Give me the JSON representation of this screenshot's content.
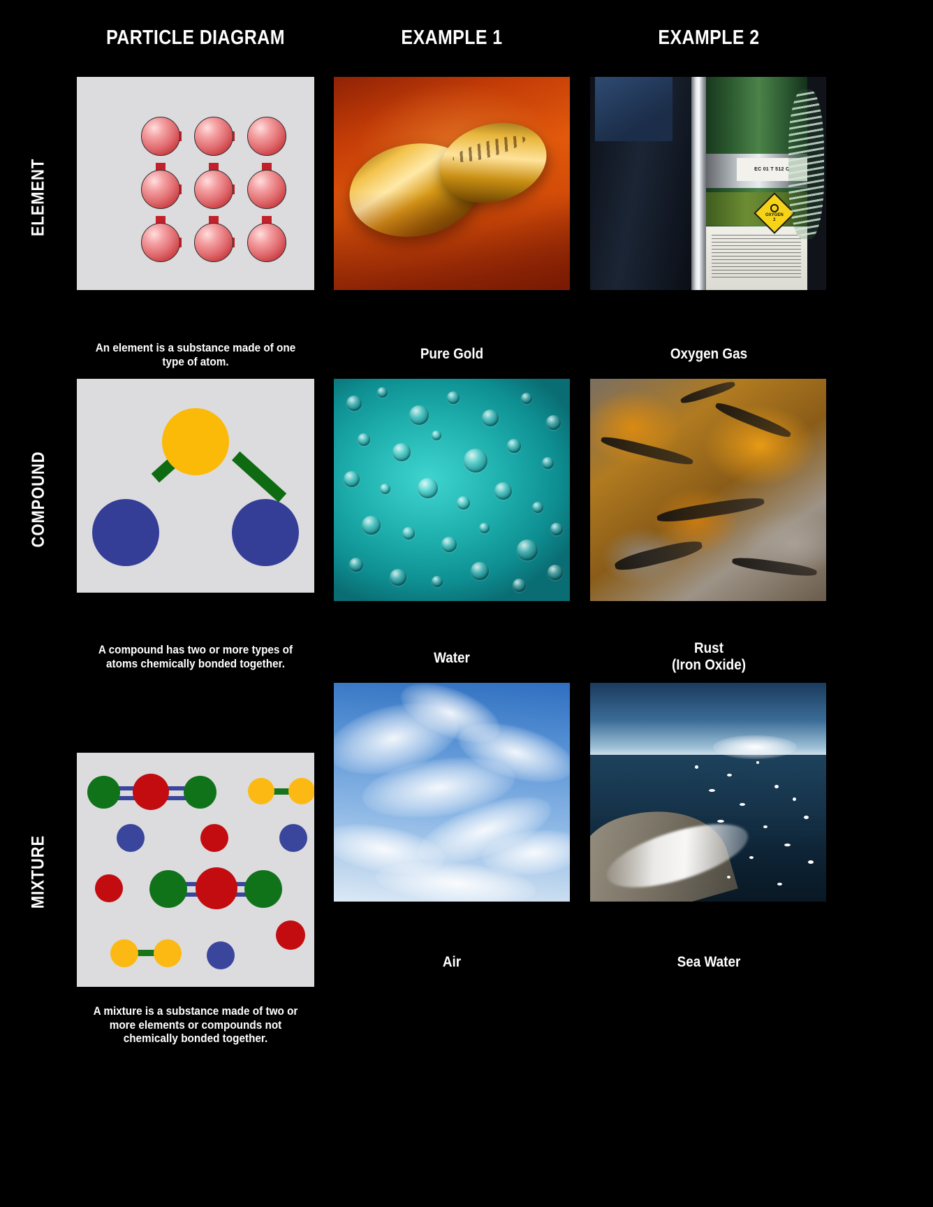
{
  "background_color": "#000000",
  "text_color": "#ffffff",
  "panel_background": "#dcdcde",
  "columns": [
    {
      "id": "particle-diagram",
      "header": "PARTICLE DIAGRAM"
    },
    {
      "id": "example-1",
      "header": "EXAMPLE 1"
    },
    {
      "id": "example-2",
      "header": "EXAMPLE 2"
    }
  ],
  "rows": [
    {
      "id": "element",
      "label": "ELEMENT",
      "description": "An element is a substance made of one type of atom.",
      "example_1": {
        "label": "Pure Gold",
        "image": "two gold wedding rings on a wooden surface"
      },
      "example_2": {
        "label": "Oxygen Gas",
        "image": "green medical oxygen cylinder with OXYGEN 2 hazard label"
      },
      "diagram": {
        "type": "lattice-grid",
        "atom_types": 1,
        "atom_count": 9,
        "rows": 3,
        "cols": 3,
        "atom_color": "#cc3b40",
        "bond_color": "#c2202a"
      }
    },
    {
      "id": "compound",
      "label": "COMPOUND",
      "description": "A compound has two or more types of atoms chemically bonded together.",
      "example_1": {
        "label": "Water",
        "image": "water droplets on a teal surface"
      },
      "example_2": {
        "label": "Rust\n(Iron Oxide)",
        "image": "orange rusted rock surface"
      },
      "diagram": {
        "type": "molecule",
        "atom_types": 2,
        "atom_count": 3,
        "center_atom_color": "#fbb908",
        "outer_atom_color": "#353e97",
        "bond_color": "#0e6b11"
      }
    },
    {
      "id": "mixture",
      "label": "MIXTURE",
      "description": "A mixture is a substance made of two or more elements or compounds not chemically bonded together.",
      "example_1": {
        "label": "Air",
        "image": "blue sky with wispy cirrus clouds"
      },
      "example_2": {
        "label": "Sea Water",
        "image": "sunlit ocean waves meeting a beach"
      },
      "diagram": {
        "type": "scattered-particles",
        "atom_colors": {
          "green": "#10731a",
          "red": "#c20c10",
          "blue": "#3a459c",
          "yellow": "#fcb913"
        },
        "bond_colors": {
          "blue": "#3a459c",
          "green": "#16741a"
        },
        "particle_count": 18,
        "molecule_count": 4
      }
    }
  ],
  "oxygen_tank": {
    "top_label": "EC 01 T 512 C",
    "hazard_label": "OXYGEN",
    "hazard_class": "2"
  }
}
